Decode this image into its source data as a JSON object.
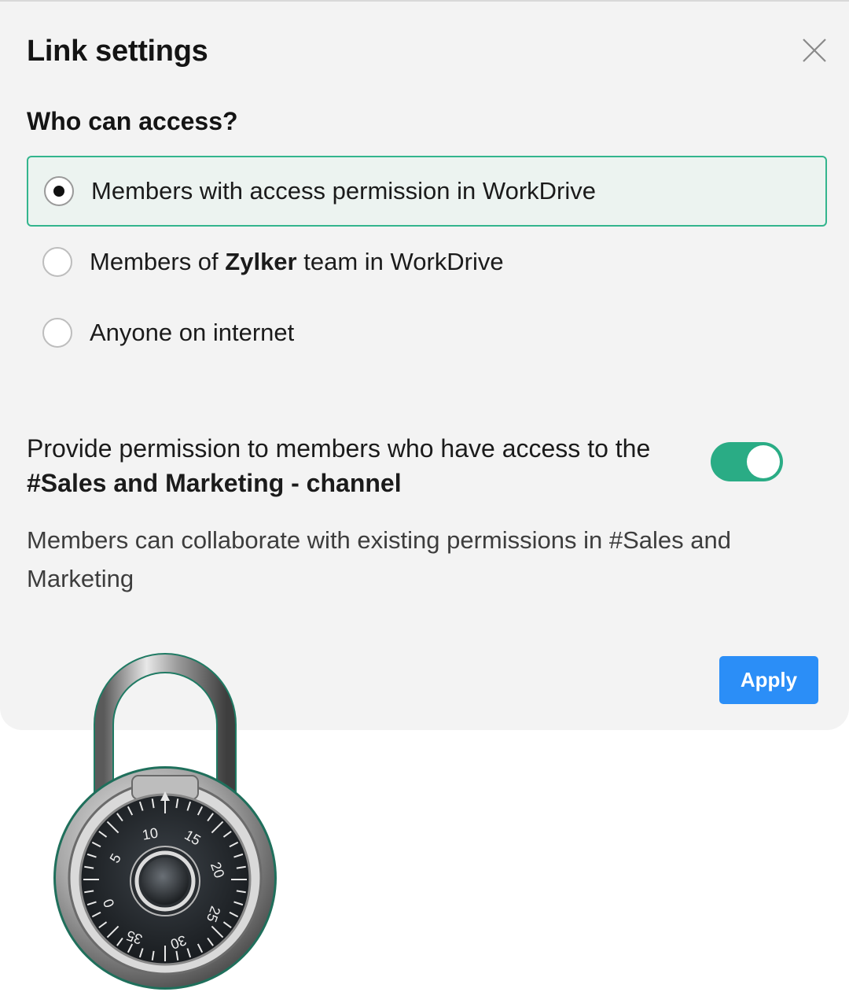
{
  "dialog": {
    "title": "Link settings",
    "close_icon": "close-icon"
  },
  "access": {
    "heading": "Who can access?",
    "options": [
      {
        "label": "Members with access permission in WorkDrive",
        "selected": true
      },
      {
        "label_prefix": "Members of ",
        "label_bold": "Zylker",
        "label_suffix": " team in WorkDrive",
        "selected": false
      },
      {
        "label": "Anyone on internet",
        "selected": false
      }
    ]
  },
  "permission": {
    "text": "Provide permission to members who have access to the",
    "channel": "#Sales and Marketing - channel",
    "toggle_on": true,
    "note": "Members can collaborate with existing permissions in #Sales and Marketing"
  },
  "actions": {
    "apply_label": "Apply"
  },
  "decoration": {
    "icon": "combination-padlock",
    "dial_numbers": [
      "0",
      "5",
      "10",
      "15",
      "20",
      "25",
      "30",
      "35"
    ]
  },
  "colors": {
    "accent_green": "#2aac85",
    "selected_border": "#33b58d",
    "apply_blue": "#2b8ef7",
    "dialog_bg": "#f3f3f3"
  }
}
